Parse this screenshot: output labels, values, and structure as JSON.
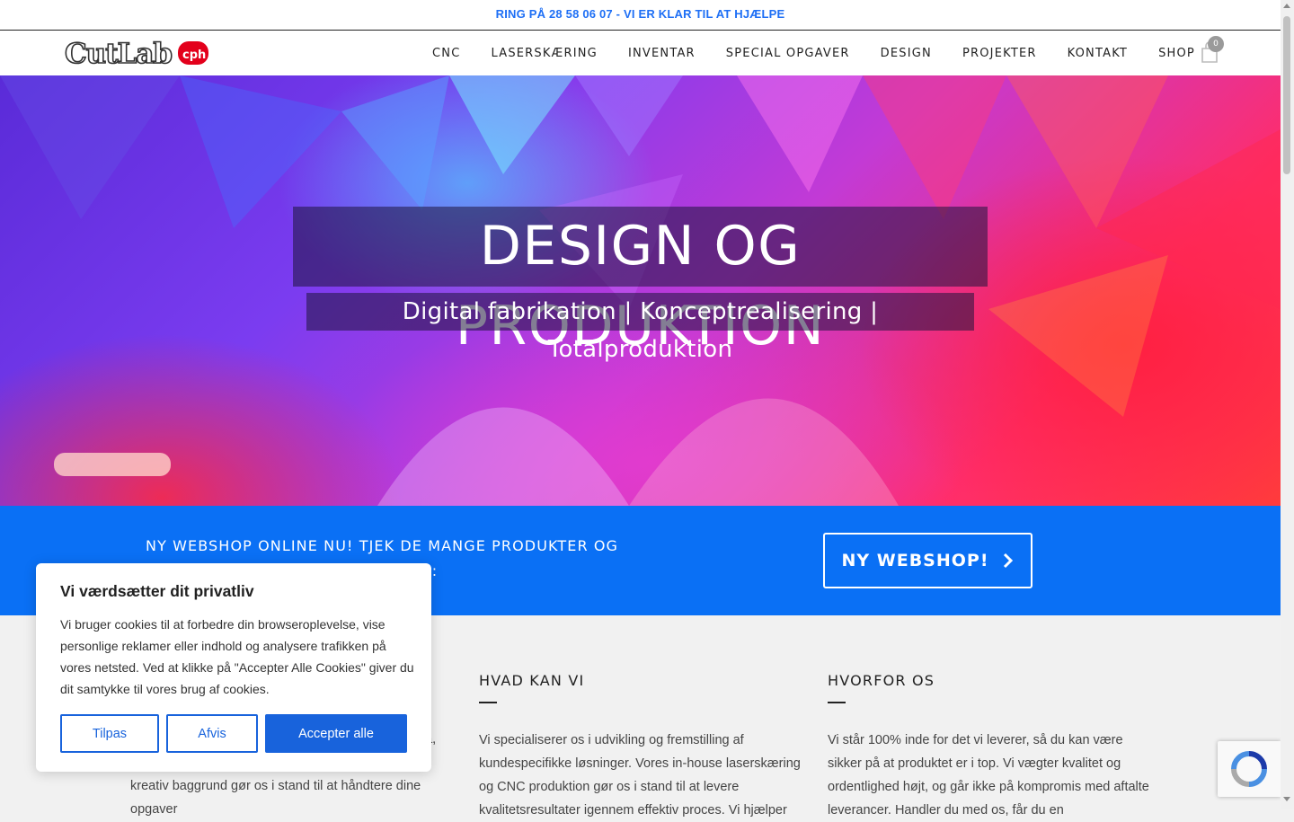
{
  "topbar": {
    "text": "RING PÅ 28 58 06 07 - VI ER KLAR TIL AT HJÆLPE"
  },
  "brand": {
    "logo_text": "CutLab",
    "logo_badge": "cph",
    "accent": "#e3001b"
  },
  "nav": {
    "items": [
      {
        "label": "CNC"
      },
      {
        "label": "LASERSKÆRING"
      },
      {
        "label": "INVENTAR"
      },
      {
        "label": "SPECIAL OPGAVER"
      },
      {
        "label": "DESIGN"
      },
      {
        "label": "PROJEKTER"
      },
      {
        "label": "KONTAKT"
      },
      {
        "label": "SHOP"
      }
    ],
    "cart_count": "0"
  },
  "hero": {
    "title": "DESIGN OG PRODUKTION",
    "subtitle": "Digital fabrikation | Konceptrealisering | Totalproduktion"
  },
  "promo": {
    "text_line1": "NY WEBSHOP ONLINE NU! TJEK DE MANGE PRODUKTER OG",
    "text_line2": "R:",
    "button_label": "NY WEBSHOP!",
    "bg_color": "#0a70f5"
  },
  "columns": {
    "col1": {
      "text": "na, og produktionsfasen. Kombinationen af teknisk og kreativ baggrund gør os i stand til at håndtere dine opgaver"
    },
    "col2": {
      "heading": "HVAD KAN VI",
      "text": "Vi specialiserer os i udvikling og fremstilling af kundespecifikke løsninger. Vores in-house laserskæring og CNC produktion gør os i stand til at levere kvalitetsresultater igennem effektiv proces. Vi hjælper"
    },
    "col3": {
      "heading": "HVORFOR OS",
      "text": "Vi står 100% inde for det vi leverer, så du kan være sikker på at produktet er i top. Vi vægter kvalitet og ordentlighed højt, og går ikke på kompromis med aftalte leverancer. Handler du med os, får du en"
    }
  },
  "cookie": {
    "title": "Vi værdsætter dit privatliv",
    "body": "Vi bruger cookies til at forbedre din browseroplevelse, vise personlige reklamer eller indhold og analysere trafikken på vores netsted. Ved at klikke på \"Accepter Alle Cookies\" giver du dit samtykke til vores brug af cookies.",
    "btn_customize": "Tilpas",
    "btn_reject": "Afvis",
    "btn_accept": "Accepter alle",
    "accent": "#1863dc"
  }
}
